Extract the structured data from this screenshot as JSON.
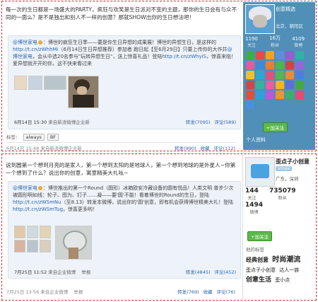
{
  "post1": {
    "text_a": "每一次的生日都是一场盛大的PARTY，疯狂与欢笑是生日派对不变的主题，那你的生日会有与众不同的一面么？是不是独出和别人不一样的创意？那就SHOW出你的生日想法吧！",
    "repost": {
      "author": "@博世家电",
      "body_a": "：博世的疯狂生日季——要是你生日异想的成果展！博世的异想生日，是这样的",
      "link1": "http://t.cn/zWhhMi",
      "body_b": "（6月14日生日异想推荐）参加者 跑日起【至6月29日】只要上传你的大作并",
      "mention": "@博世家电",
      "body_c": "，会从中选20名参与\"玩转异想生日\"，送上惊喜礼品！登陆",
      "link2": "http://t.cn/zWhyiS",
      "body_d": "，惊喜来临！爱异想就开开的你，这不快来看过来",
      "time": "6月14日 15:30",
      "source": "来自新浪微博企业新",
      "forward": "转发(7095)",
      "comment": "评论(589)"
    },
    "tags_label": "标签：",
    "tags": [
      "always",
      "BF"
    ],
    "footer_time": "6月14日 15:48",
    "footer_source": "来自新浪微博企业新",
    "footer_forward": "转发(990)",
    "footer_fav": "收藏",
    "footer_comment": "评论(112)"
  },
  "side1": {
    "name": "创意精选",
    "location": "北京，朝阳区",
    "stats": [
      {
        "num": "1190",
        "label": "关注"
      },
      {
        "num": "16万",
        "label": "粉丝"
      },
      {
        "num": "4109",
        "label": "微博"
      }
    ],
    "follow": "+加关注",
    "section": "个人资料"
  },
  "post2": {
    "text_a": "说到圆第一个想到月亮的是家人，第一个想到太阳的是地球人，第一个想到地球的是外星人~你第一个想到了什么？说出你的创意，寓意精美大礼吆~",
    "repost": {
      "author": "@博世家电",
      "body_a": "：博世推出的第一个Round（圆形）冰箱欧安冷藏设备的圆有悦品！人类文明 普步少次被圆形啊如线：轮子、图为、钉子……凝——要'圆'不能！看着博世的Round的生日，登陆",
      "link1": "http://t.cn/zWSmNu",
      "body_b": "（至8.13）转发本微博，说出你的'圆'创意，即有机会获得博世精美大礼！登陆",
      "link2": "http://t.cn/zWSmTug",
      "body_c": "，惊喜更多哟！",
      "time": "7月25日 11:52",
      "source": "来自企业微博",
      "report": "举报",
      "forward": "转发(4845)",
      "comment": "评论(452)"
    },
    "footer_time": "7月25日 13:56",
    "footer_source": "来自企业微博",
    "footer_report": "举报",
    "footer_forward": "转发(769)",
    "footer_fav": "收藏",
    "footer_comment": "评论(76)"
  },
  "side2": {
    "name": "歪点子小创意",
    "badge": "Vmax",
    "location": "广东，深圳",
    "stats": [
      {
        "num": "144",
        "label": "关注"
      },
      {
        "num": "735079",
        "label": "粉丝"
      },
      {
        "num": "1494",
        "label": "微博"
      }
    ],
    "follow": "+加关注",
    "tags_title": "他的标签",
    "cloud": [
      "经典创意",
      "时尚潮流",
      "歪点子小创意",
      "达人一族",
      "创意生活",
      "歪小点"
    ]
  }
}
